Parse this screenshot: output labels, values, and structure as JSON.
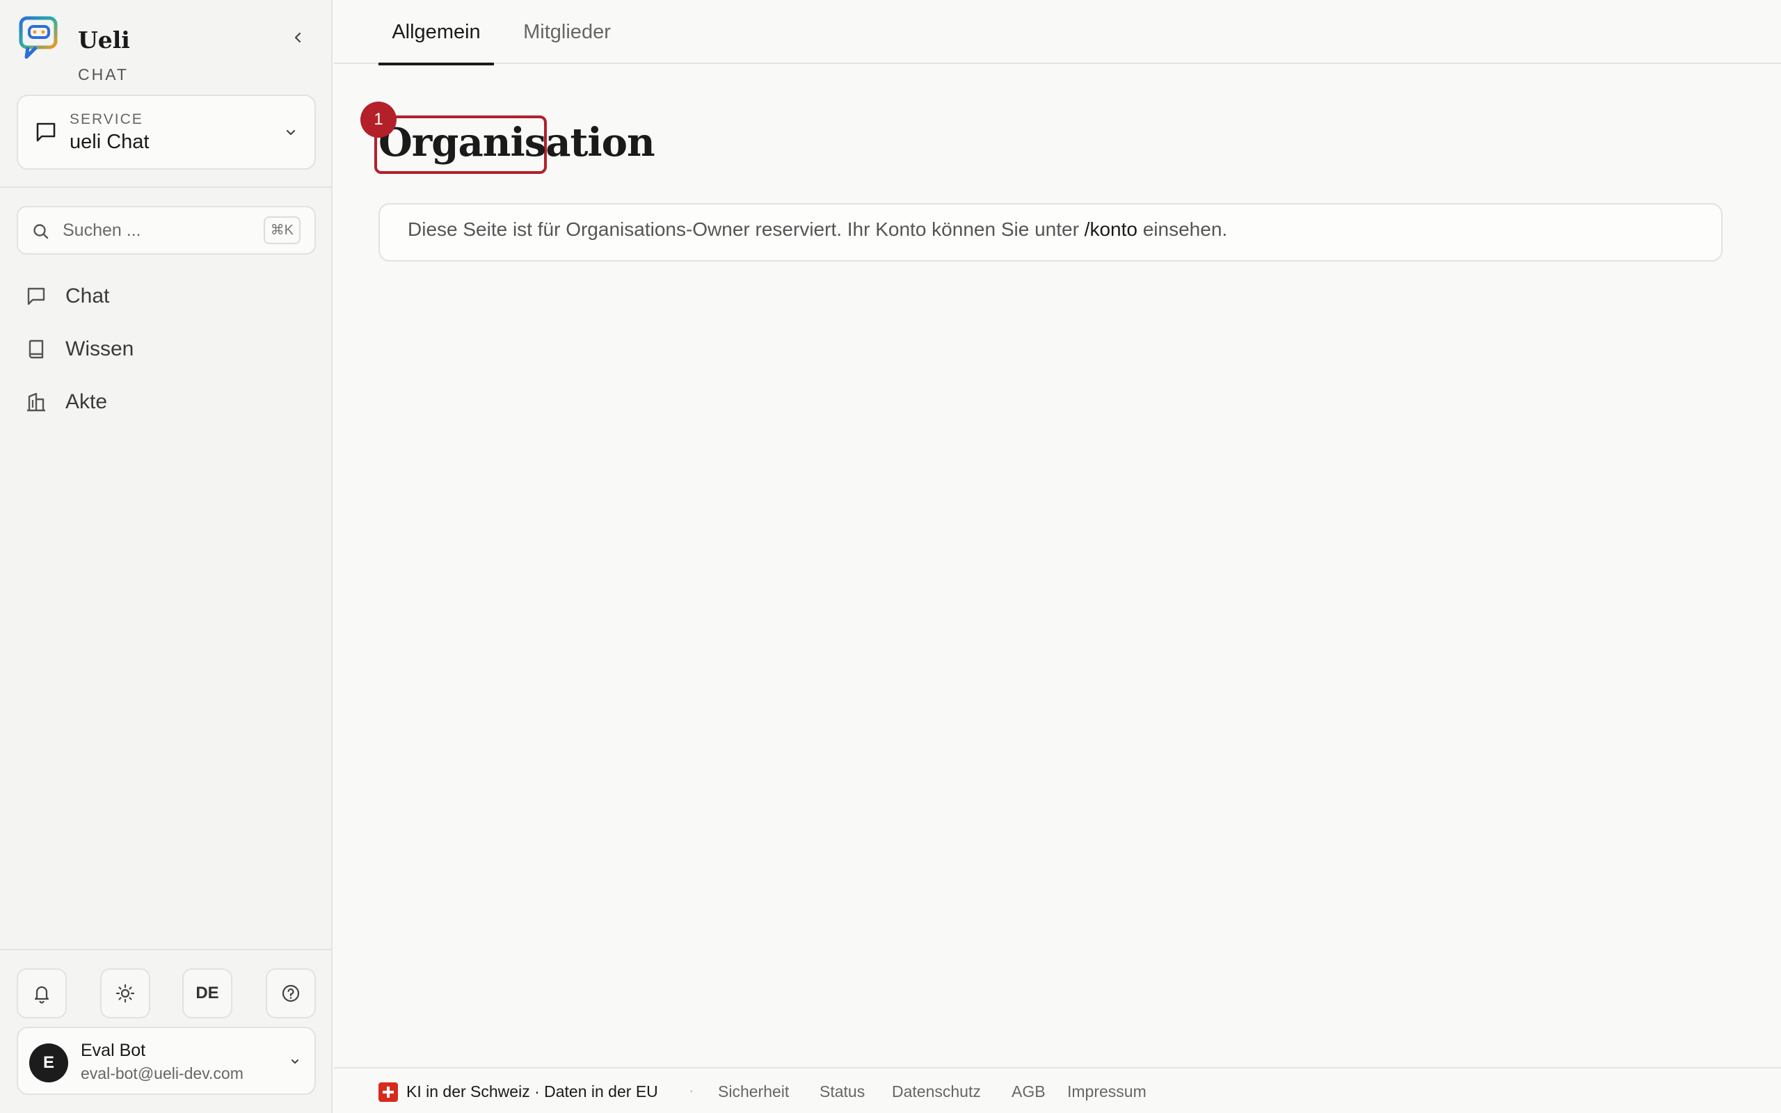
{
  "sidebar": {
    "brand": {
      "name": "Ueli",
      "sub": "CHAT"
    },
    "service": {
      "label": "SERVICE",
      "value": "ueli Chat"
    },
    "search": {
      "placeholder": "Suchen ...",
      "shortcut": "⌘K"
    },
    "nav": [
      {
        "label": "Chat",
        "icon": "chat-bubble-icon"
      },
      {
        "label": "Wissen",
        "icon": "book-icon"
      },
      {
        "label": "Akte",
        "icon": "building-icon"
      }
    ],
    "tools": {
      "language": "DE"
    },
    "user": {
      "initial": "E",
      "name": "Eval Bot",
      "email": "eval-bot@ueli-dev.com"
    }
  },
  "main": {
    "tabs": [
      {
        "label": "Allgemein",
        "active": true
      },
      {
        "label": "Mitglieder",
        "active": false
      }
    ],
    "annotation_badge": "1",
    "title": "Organisation",
    "notice": {
      "before": "Diese Seite ist für Organisations-Owner reserviert. Ihr Konto können Sie unter ",
      "link": "/konto",
      "after": " einsehen."
    }
  },
  "footer": {
    "claim": "KI in der Schweiz · Daten in der EU",
    "separator": "·",
    "links": [
      "Sicherheit",
      "Status",
      "Datenschutz",
      "AGB",
      "Impressum"
    ]
  },
  "colors": {
    "accent": "#b3202a",
    "swiss_red": "#d52b1e",
    "sidebar_bg": "#f4f4f3",
    "page_bg": "#f9f9f8"
  }
}
